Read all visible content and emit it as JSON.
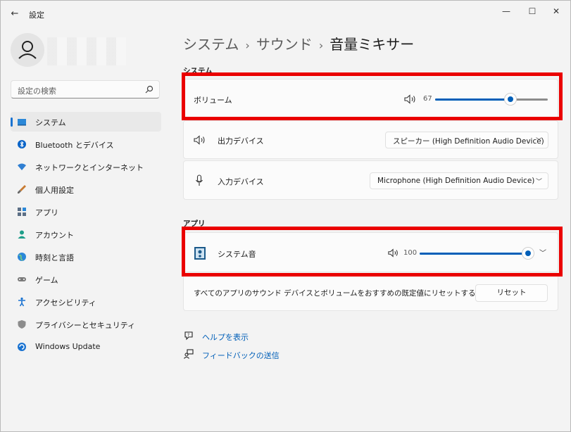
{
  "titlebar": {
    "title": "設定",
    "back_icon": "arrow-left-icon",
    "min": "—",
    "max": "☐",
    "close": "✕"
  },
  "sidebar": {
    "search_placeholder": "設定の検索",
    "items": [
      {
        "label": "システム",
        "icon": "system-icon",
        "active": true
      },
      {
        "label": "Bluetooth とデバイス",
        "icon": "bluetooth-icon"
      },
      {
        "label": "ネットワークとインターネット",
        "icon": "wifi-icon"
      },
      {
        "label": "個人用設定",
        "icon": "brush-icon"
      },
      {
        "label": "アプリ",
        "icon": "apps-icon"
      },
      {
        "label": "アカウント",
        "icon": "account-icon"
      },
      {
        "label": "時刻と言語",
        "icon": "globe-icon"
      },
      {
        "label": "ゲーム",
        "icon": "gamepad-icon"
      },
      {
        "label": "アクセシビリティ",
        "icon": "accessibility-icon"
      },
      {
        "label": "プライバシーとセキュリティ",
        "icon": "shield-icon"
      },
      {
        "label": "Windows Update",
        "icon": "update-icon"
      }
    ]
  },
  "breadcrumb": {
    "first": "システム",
    "second": "サウンド",
    "current": "音量ミキサー",
    "separator": "›"
  },
  "system_section": {
    "label": "システム",
    "volume": {
      "label": "ボリューム",
      "value": "67",
      "level": 0.67
    },
    "output": {
      "label": "出力デバイス",
      "selected": "スピーカー (High Definition Audio Device)"
    },
    "input": {
      "label": "入力デバイス",
      "selected": "Microphone (High Definition Audio Device)"
    }
  },
  "apps_section": {
    "label": "アプリ",
    "system_sounds": {
      "label": "システム音",
      "value": "100",
      "level": 1.0
    },
    "reset_text": "すべてのアプリのサウンド デバイスとボリュームをおすすめの既定値にリセットする",
    "reset_button": "リセット"
  },
  "links": {
    "help": "ヘルプを表示",
    "feedback": "フィードバックの送信"
  },
  "colors": {
    "accent": "#005fb8",
    "highlight": "#ea0000"
  }
}
